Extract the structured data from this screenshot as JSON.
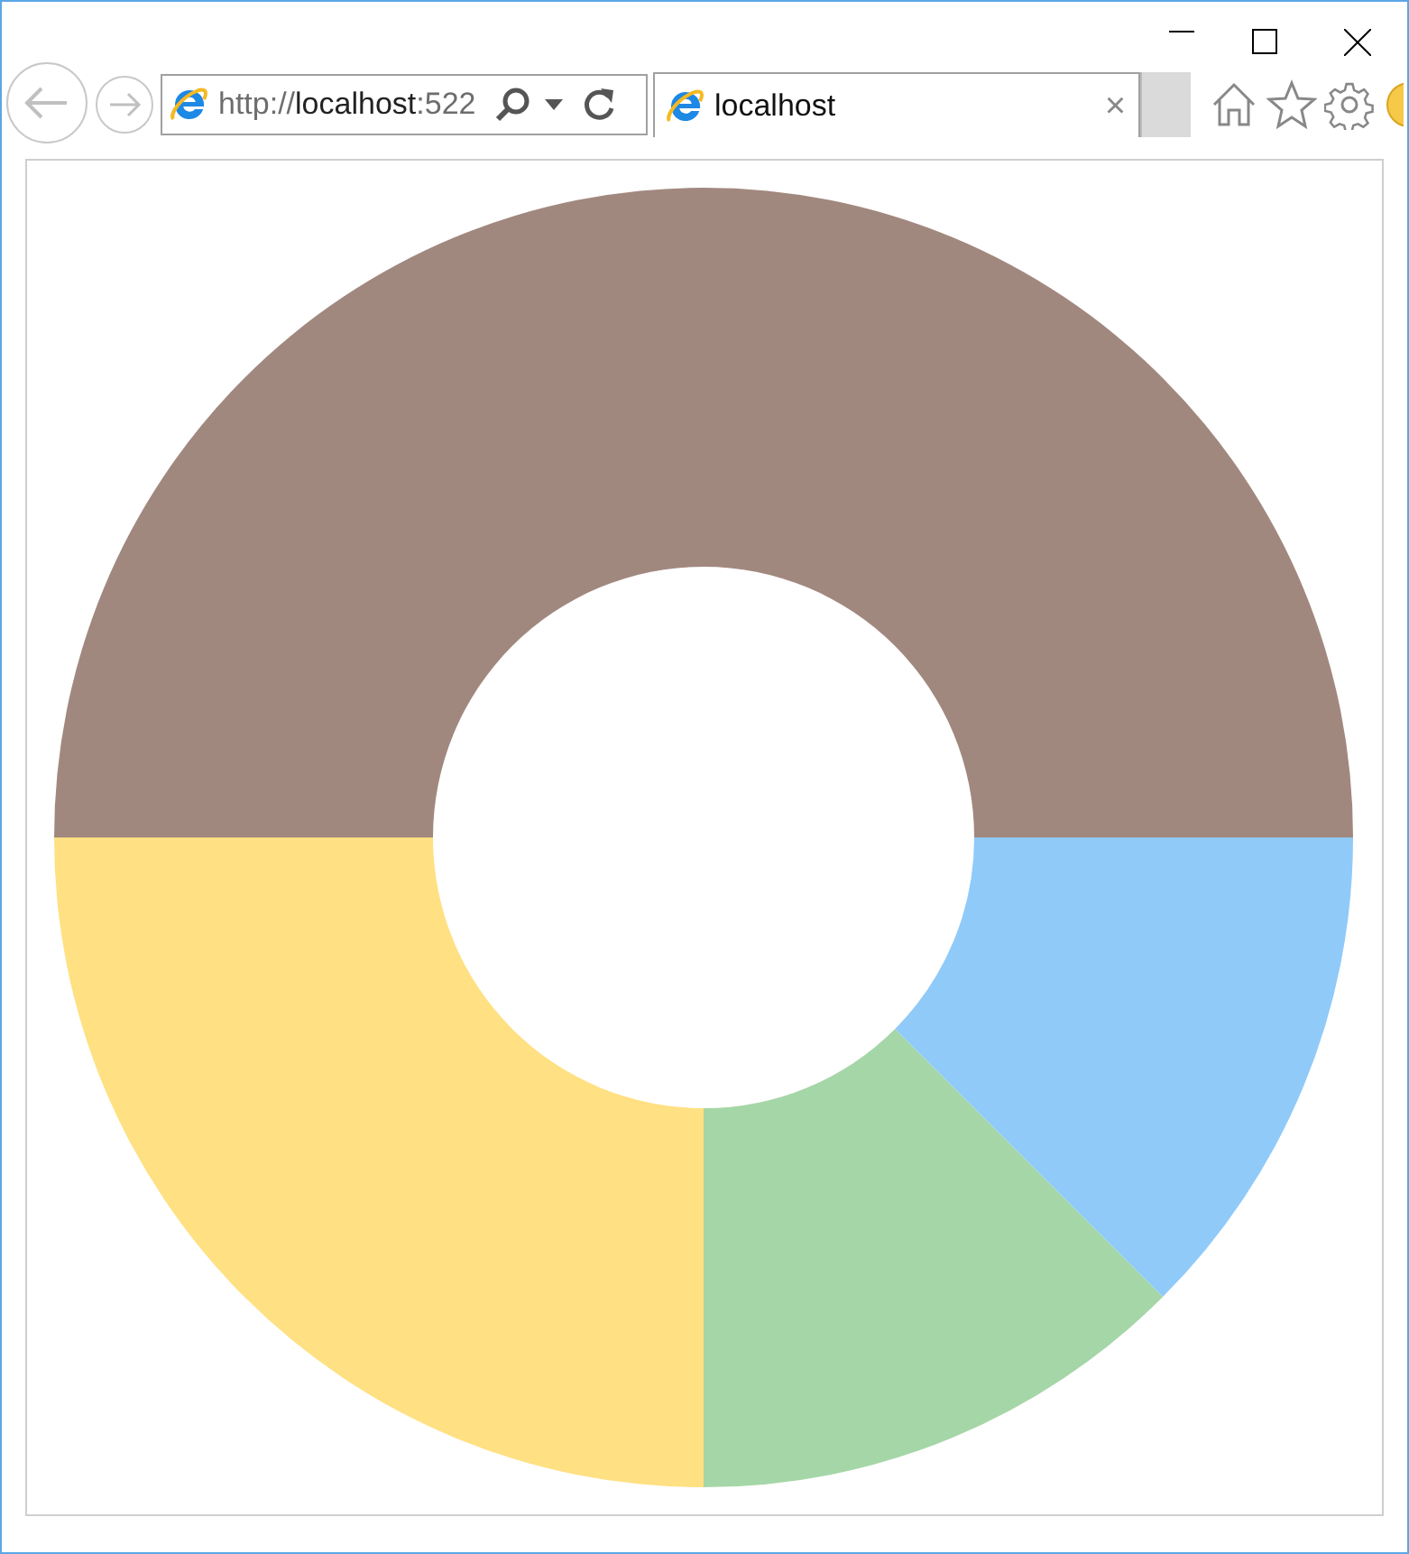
{
  "address_bar": {
    "scheme": "http://",
    "host": "localhost",
    "port": ":522"
  },
  "tabs": [
    {
      "title": "localhost",
      "close": "×",
      "selected": true
    }
  ]
}
